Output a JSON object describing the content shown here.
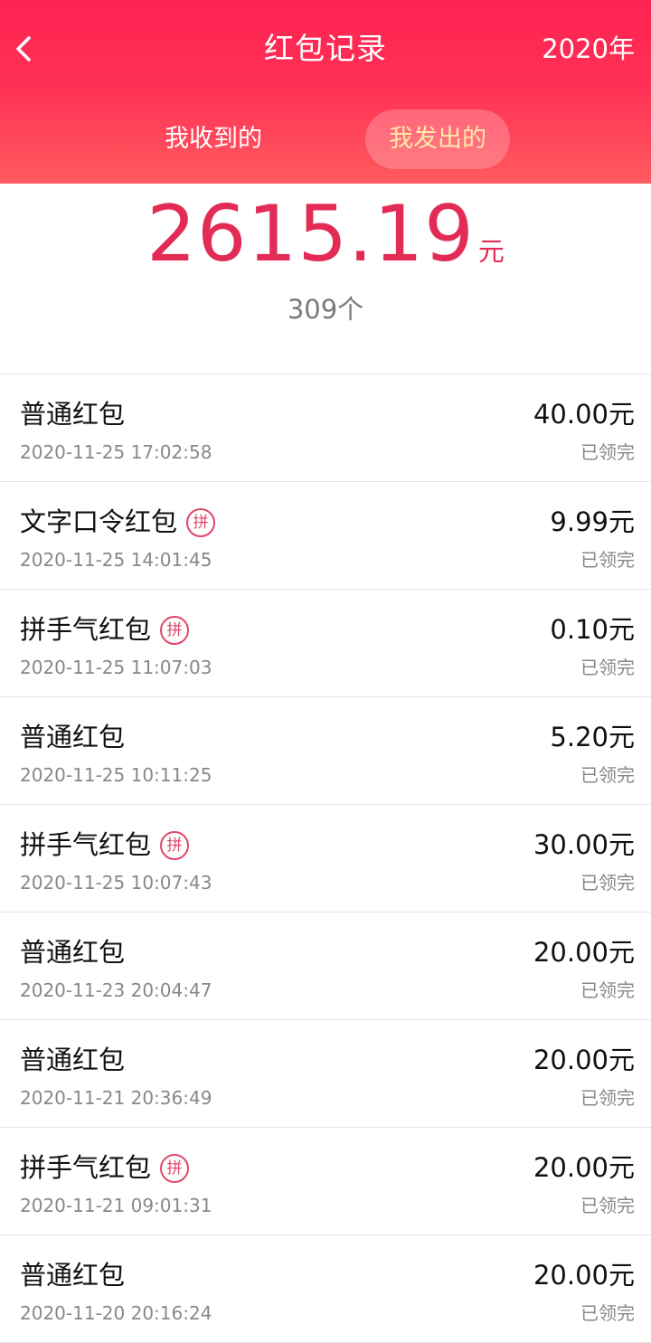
{
  "header": {
    "title": "红包记录",
    "year": "2020年",
    "back_icon": "chevron-left-icon",
    "background_color": "#ff2a55"
  },
  "tabs": [
    {
      "label": "我收到的",
      "active": false
    },
    {
      "label": "我发出的",
      "active": true
    }
  ],
  "summary": {
    "total_amount": "2615.19",
    "unit": "元",
    "count": "309个",
    "accent_color": "#e32c55"
  },
  "records": [
    {
      "type": "普通红包",
      "badge": "",
      "date": "2020-11-25 17:02:58",
      "amount": "40.00元",
      "status": "已领完"
    },
    {
      "type": "文字口令红包",
      "badge": "拼",
      "date": "2020-11-25 14:01:45",
      "amount": "9.99元",
      "status": "已领完"
    },
    {
      "type": "拼手气红包",
      "badge": "拼",
      "date": "2020-11-25 11:07:03",
      "amount": "0.10元",
      "status": "已领完"
    },
    {
      "type": "普通红包",
      "badge": "",
      "date": "2020-11-25 10:11:25",
      "amount": "5.20元",
      "status": "已领完"
    },
    {
      "type": "拼手气红包",
      "badge": "拼",
      "date": "2020-11-25 10:07:43",
      "amount": "30.00元",
      "status": "已领完"
    },
    {
      "type": "普通红包",
      "badge": "",
      "date": "2020-11-23 20:04:47",
      "amount": "20.00元",
      "status": "已领完"
    },
    {
      "type": "普通红包",
      "badge": "",
      "date": "2020-11-21 20:36:49",
      "amount": "20.00元",
      "status": "已领完"
    },
    {
      "type": "拼手气红包",
      "badge": "拼",
      "date": "2020-11-21 09:01:31",
      "amount": "20.00元",
      "status": "已领完"
    },
    {
      "type": "普通红包",
      "badge": "",
      "date": "2020-11-20 20:16:24",
      "amount": "20.00元",
      "status": "已领完"
    }
  ]
}
